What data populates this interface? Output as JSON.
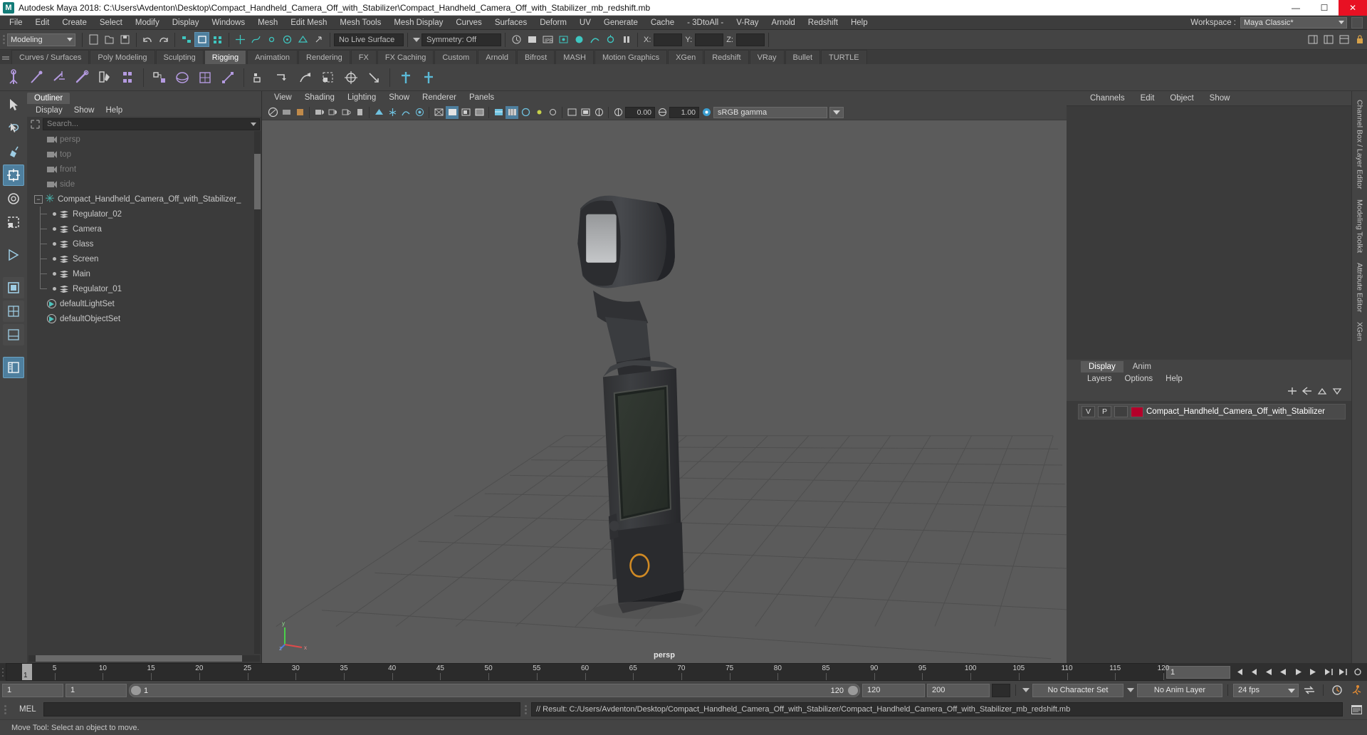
{
  "window": {
    "title": "Autodesk Maya 2018: C:\\Users\\Avdenton\\Desktop\\Compact_Handheld_Camera_Off_with_Stabilizer\\Compact_Handheld_Camera_Off_with_Stabilizer_mb_redshift.mb",
    "logo": "M",
    "minimize": "—",
    "maximize": "☐",
    "close": "✕"
  },
  "menubar": {
    "items": [
      "File",
      "Edit",
      "Create",
      "Select",
      "Modify",
      "Display",
      "Windows",
      "Mesh",
      "Edit Mesh",
      "Mesh Tools",
      "Mesh Display",
      "Curves",
      "Surfaces",
      "Deform",
      "UV",
      "Generate",
      "Cache",
      "- 3DtoAll -",
      "V-Ray",
      "Arnold",
      "Redshift",
      "Help"
    ],
    "workspace_label": "Workspace :",
    "workspace_value": "Maya Classic*"
  },
  "statusline": {
    "mode": "Modeling",
    "live_surface": "No Live Surface",
    "symmetry": "Symmetry: Off",
    "coord_x_label": "X:",
    "coord_y_label": "Y:",
    "coord_z_label": "Z:",
    "coord_x": "",
    "coord_y": "",
    "coord_z": ""
  },
  "shelf": {
    "tabs": [
      "Curves / Surfaces",
      "Poly Modeling",
      "Sculpting",
      "Rigging",
      "Animation",
      "Rendering",
      "FX",
      "FX Caching",
      "Custom",
      "Arnold",
      "Bifrost",
      "MASH",
      "Motion Graphics",
      "XGen",
      "Redshift",
      "VRay",
      "Bullet",
      "TURTLE"
    ],
    "active_tab": "Rigging"
  },
  "outliner": {
    "tab": "Outliner",
    "menu": [
      "Display",
      "Show",
      "Help"
    ],
    "search_placeholder": "Search...",
    "items": [
      {
        "label": "persp",
        "type": "camera",
        "depth": 1,
        "dim": true
      },
      {
        "label": "top",
        "type": "camera",
        "depth": 1,
        "dim": true
      },
      {
        "label": "front",
        "type": "camera",
        "depth": 1,
        "dim": true
      },
      {
        "label": "side",
        "type": "camera",
        "depth": 1,
        "dim": true
      },
      {
        "label": "Compact_Handheld_Camera_Off_with_Stabilizer_",
        "type": "group",
        "depth": 0,
        "dim": false
      },
      {
        "label": "Regulator_02",
        "type": "mesh",
        "depth": 2,
        "dim": false
      },
      {
        "label": "Camera",
        "type": "mesh",
        "depth": 2,
        "dim": false
      },
      {
        "label": "Glass",
        "type": "mesh",
        "depth": 2,
        "dim": false
      },
      {
        "label": "Screen",
        "type": "mesh",
        "depth": 2,
        "dim": false
      },
      {
        "label": "Main",
        "type": "mesh",
        "depth": 2,
        "dim": false
      },
      {
        "label": "Regulator_01",
        "type": "mesh",
        "depth": 2,
        "dim": false,
        "last": true
      },
      {
        "label": "defaultLightSet",
        "type": "set",
        "depth": 1,
        "dim": false
      },
      {
        "label": "defaultObjectSet",
        "type": "set",
        "depth": 1,
        "dim": false
      }
    ]
  },
  "viewport": {
    "menu": [
      "View",
      "Shading",
      "Lighting",
      "Show",
      "Renderer",
      "Panels"
    ],
    "exposure": "0.00",
    "gamma_value": "1.00",
    "color_space": "sRGB gamma",
    "camera_label": "persp",
    "axis": {
      "x": "x",
      "y": "y",
      "z": "z"
    }
  },
  "channelbox": {
    "menu": [
      "Channels",
      "Edit",
      "Object",
      "Show"
    ]
  },
  "layers": {
    "tabs": [
      "Display",
      "Anim"
    ],
    "active_tab": "Display",
    "menu": [
      "Layers",
      "Options",
      "Help"
    ],
    "rows": [
      {
        "v": "V",
        "p": "P",
        "color": "#b4002a",
        "name": "Compact_Handheld_Camera_Off_with_Stabilizer"
      }
    ]
  },
  "right_tabs": [
    "Channel Box / Layer Editor",
    "Modeling Toolkit",
    "Attribute Editor",
    "XGen"
  ],
  "timeline": {
    "ticks": [
      5,
      10,
      15,
      20,
      25,
      30,
      35,
      40,
      45,
      50,
      55,
      60,
      65,
      70,
      75,
      80,
      85,
      90,
      95,
      100,
      105,
      110,
      115,
      120
    ],
    "current_frame": "1",
    "current_frame_field": "1",
    "max_frames": 120
  },
  "rangebar": {
    "start": "1",
    "start2": "1",
    "range_left": "1",
    "range_right": "120",
    "end": "120",
    "playback_end": "200",
    "character_set": "No Character Set",
    "anim_layer": "No Anim Layer",
    "fps": "24 fps"
  },
  "command": {
    "label": "MEL",
    "input_value": "",
    "result": "// Result: C:/Users/Avdenton/Desktop/Compact_Handheld_Camera_Off_with_Stabilizer/Compact_Handheld_Camera_Off_with_Stabilizer_mb_redshift.mb"
  },
  "helpline": {
    "text": "Move Tool: Select an object to move."
  },
  "colors": {
    "accent_blue": "#4e7f9e",
    "viewport_bg": "#5b5b5b",
    "panel_bg": "#3b3b3b",
    "chrome_bg": "#444444",
    "layer_color": "#b4002a",
    "teal": "#49b7b0"
  }
}
